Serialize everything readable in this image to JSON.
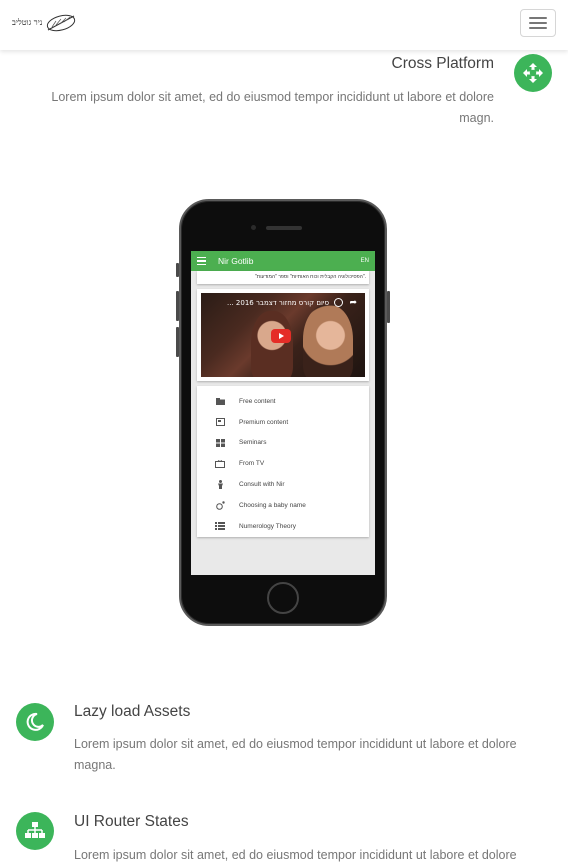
{
  "navbar": {
    "brand_text": "ניר גוטליב",
    "menu_icon": "hamburger-icon"
  },
  "features": {
    "cross_platform": {
      "title": "Cross Platform",
      "description": "Lorem ipsum dolor sit amet, ed do eiusmod tempor incididunt ut labore et dolore magn.",
      "icon": "arrows-move-icon"
    },
    "lazy_load": {
      "title": "Lazy load Assets",
      "description": "Lorem ipsum dolor sit amet, ed do eiusmod tempor incididunt ut labore et dolore magna.",
      "icon": "moon-icon"
    },
    "ui_router": {
      "title": "UI Router States",
      "description": "Lorem ipsum dolor sit amet, ed do eiusmod tempor incididunt ut labore et dolore",
      "icon": "sitemap-icon"
    }
  },
  "phone_app": {
    "title": "Nir Gotlib",
    "lang": "EN",
    "card_text": "\"הפסיכולוגיה הקבלית וכוח האותיות\" וספר \"המודעות\".",
    "video_title": "סיום קורס מחזור דצמבר 2016 ...",
    "menu": [
      {
        "label": "Free content",
        "icon": "folder-icon"
      },
      {
        "label": "Premium content",
        "icon": "premium-icon"
      },
      {
        "label": "Seminars",
        "icon": "grid-icon"
      },
      {
        "label": "From TV",
        "icon": "tv-icon"
      },
      {
        "label": "Consult with Nir",
        "icon": "person-icon"
      },
      {
        "label": "Choosing a baby name",
        "icon": "baby-icon"
      },
      {
        "label": "Numerology Theory",
        "icon": "list-icon"
      }
    ]
  },
  "colors": {
    "accent": "#3cb55a",
    "app_bar": "#4caf50"
  }
}
